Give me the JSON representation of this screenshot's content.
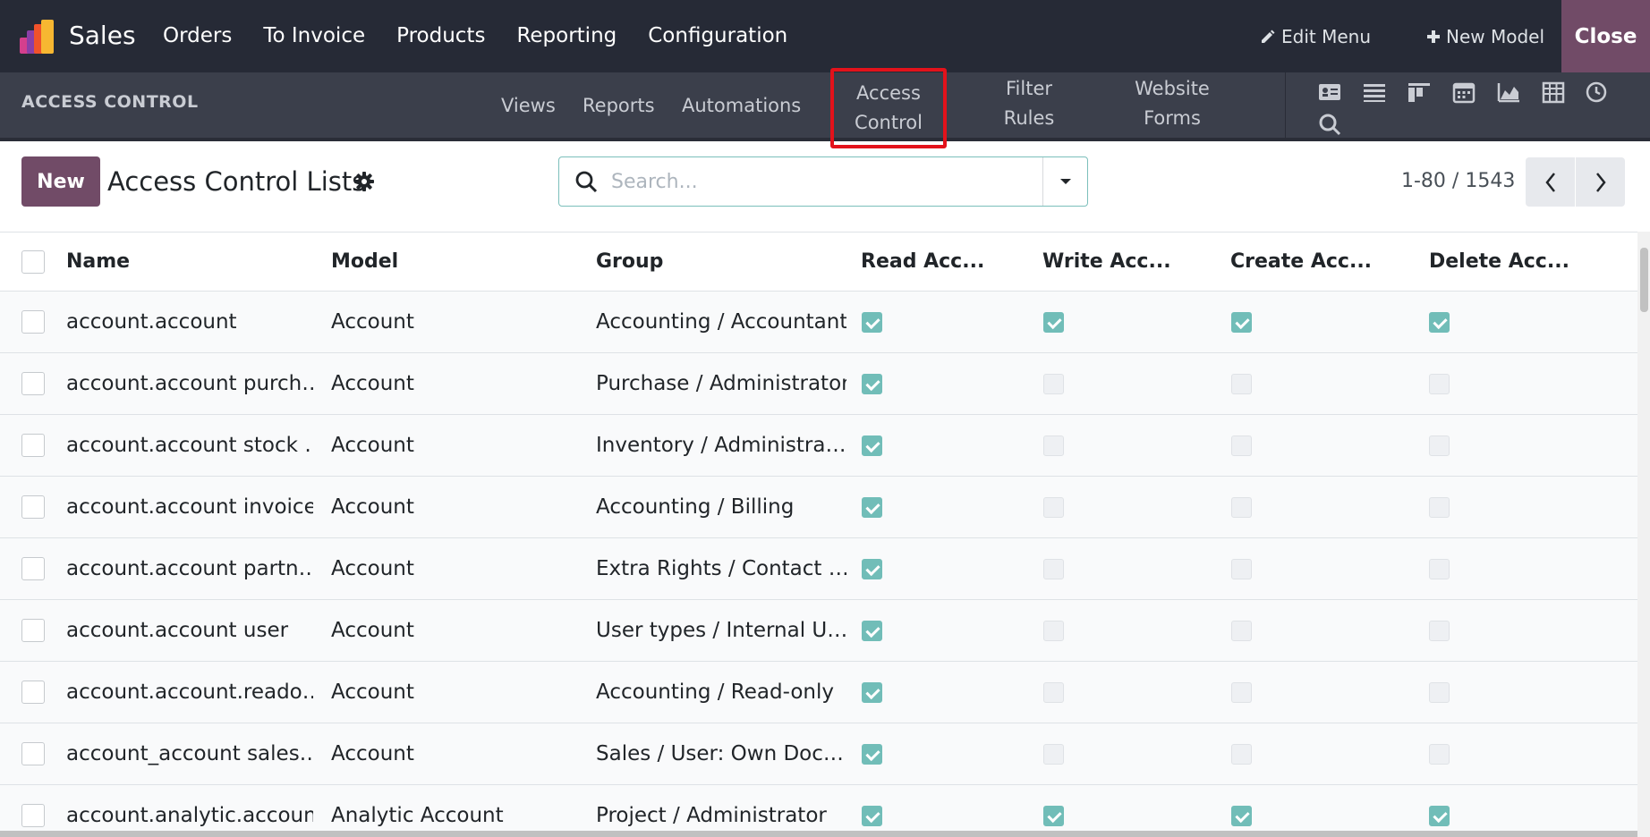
{
  "topbar": {
    "app_name": "Sales",
    "menu": [
      "Orders",
      "To Invoice",
      "Products",
      "Reporting",
      "Configuration"
    ],
    "edit_menu": "Edit Menu",
    "new_model": "New Model",
    "close": "Close"
  },
  "studio": {
    "section_title": "ACCESS CONTROL",
    "views": "Views",
    "reports": "Reports",
    "automations": "Automations",
    "access_control_line1": "Access",
    "access_control_line2": "Control",
    "filter_rules_line1": "Filter",
    "filter_rules_line2": "Rules",
    "website_forms_line1": "Website",
    "website_forms_line2": "Forms",
    "view_icons": [
      "form-view-icon",
      "list-view-icon",
      "kanban-view-icon",
      "calendar-view-icon",
      "graph-view-icon",
      "pivot-view-icon",
      "activity-view-icon",
      "search-view-icon"
    ]
  },
  "control_panel": {
    "new_label": "New",
    "title": "Access Control Lists",
    "search_placeholder": "Search...",
    "pager": "1-80 / 1543"
  },
  "table": {
    "columns": [
      "Name",
      "Model",
      "Group",
      "Read Acc...",
      "Write Acc...",
      "Create Acc...",
      "Delete Acc..."
    ],
    "rows": [
      {
        "name": "account.account",
        "model": "Account",
        "group": "Accounting / Accountant",
        "read": true,
        "write": true,
        "create": true,
        "delete": true
      },
      {
        "name": "account.account purch…",
        "model": "Account",
        "group": "Purchase / Administrator",
        "read": true,
        "write": false,
        "create": false,
        "delete": false
      },
      {
        "name": "account.account stock …",
        "model": "Account",
        "group": "Inventory / Administra…",
        "read": true,
        "write": false,
        "create": false,
        "delete": false
      },
      {
        "name": "account.account invoice",
        "model": "Account",
        "group": "Accounting / Billing",
        "read": true,
        "write": false,
        "create": false,
        "delete": false
      },
      {
        "name": "account.account partn…",
        "model": "Account",
        "group": "Extra Rights / Contact …",
        "read": true,
        "write": false,
        "create": false,
        "delete": false
      },
      {
        "name": "account.account user",
        "model": "Account",
        "group": "User types / Internal U…",
        "read": true,
        "write": false,
        "create": false,
        "delete": false
      },
      {
        "name": "account.account.reado…",
        "model": "Account",
        "group": "Accounting / Read-only",
        "read": true,
        "write": false,
        "create": false,
        "delete": false
      },
      {
        "name": "account_account sales…",
        "model": "Account",
        "group": "Sales / User: Own Doc…",
        "read": true,
        "write": false,
        "create": false,
        "delete": false
      },
      {
        "name": "account.analytic.account",
        "model": "Analytic Account",
        "group": "Project / Administrator",
        "read": true,
        "write": true,
        "create": true,
        "delete": true
      }
    ]
  },
  "colors": {
    "navbar": "#262a36",
    "subbar": "#3b3f4b",
    "brand": "#714b67",
    "checkbox_on": "#71bdb8",
    "highlight": "#e3121b"
  }
}
